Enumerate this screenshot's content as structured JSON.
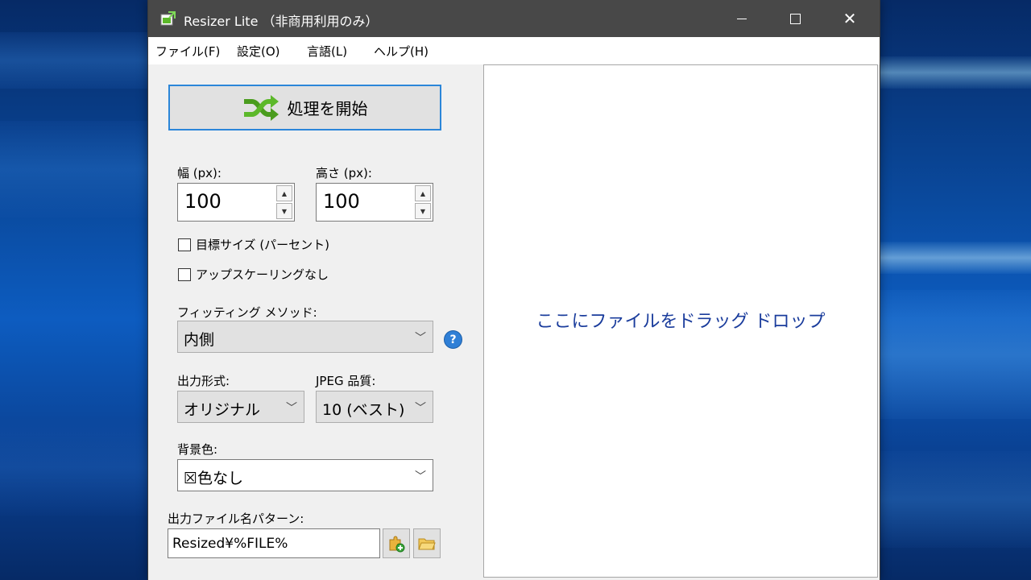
{
  "window": {
    "title": "Resizer Lite （非商用利用のみ）"
  },
  "menu": {
    "items": [
      {
        "label": "ファイル(F)"
      },
      {
        "label": "設定(O)"
      },
      {
        "label": "言語(L)"
      },
      {
        "label": "ヘルプ(H)"
      }
    ]
  },
  "panel": {
    "start_button_label": "処理を開始",
    "width_label": "幅 (px):",
    "width_value": "100",
    "height_label": "高さ (px):",
    "height_value": "100",
    "target_size_percent_label": "目標サイズ (パーセント)",
    "target_size_percent_checked": false,
    "no_upscaling_label": "アップスケーリングなし",
    "no_upscaling_checked": false,
    "fitting_method_label": "フィッティング メソッド:",
    "fitting_method_value": "内側",
    "output_format_label": "出力形式:",
    "output_format_value": "オリジナル",
    "jpeg_quality_label": "JPEG 品質:",
    "jpeg_quality_value": "10 (ベスト)",
    "background_color_label": "背景色:",
    "background_color_value": "☒色なし",
    "output_filename_label": "出力ファイル名パターン:",
    "output_filename_value": "Resized¥%FILE%"
  },
  "drop_area": {
    "text": "ここにファイルをドラッグ ドロップ"
  },
  "icons": {
    "app": "resizer-app-icon",
    "start": "shuffle-arrows-icon",
    "help": "help-icon",
    "add_token": "puzzle-add-icon",
    "browse_folder": "folder-icon"
  },
  "colors": {
    "titlebar": "#484848",
    "accent": "#2b86d9",
    "drop_text": "#1a3c9c",
    "start_icon": "#5cb82a"
  }
}
